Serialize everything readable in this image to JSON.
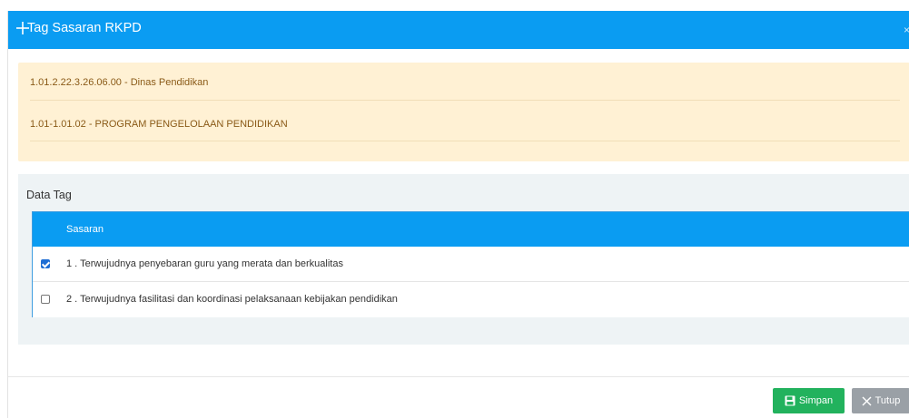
{
  "modal": {
    "title": "Tag Sasaran RKPD",
    "close_glyph": "×",
    "icons": {
      "header": "plus-icon",
      "close": "close-icon"
    }
  },
  "info": {
    "line1": "1.01.2.22.3.26.06.00 - Dinas Pendidikan",
    "line2": "1.01-1.01.02 - PROGRAM PENGELOLAAN PENDIDIKAN"
  },
  "tags": {
    "title": "Data Tag",
    "column_header": "Sasaran",
    "rows": [
      {
        "text": "1 . Terwujudnya penyebaran guru yang merata dan berkualitas",
        "checked": true
      },
      {
        "text": "2 . Terwujudnya fasilitasi dan koordinasi pelaksanaan kebijakan pendidikan",
        "checked": false
      }
    ]
  },
  "footer": {
    "save_label": "Simpan",
    "close_label": "Tutup",
    "icons": {
      "save": "save-icon",
      "close": "close-x-icon"
    }
  },
  "colors": {
    "header_blue": "#0a9cf2",
    "info_bg": "#fff1d4",
    "info_text": "#8a5a17",
    "panel_bg": "#eef3f5",
    "save_green": "#22b25d",
    "close_gray": "#9aa0a6"
  }
}
